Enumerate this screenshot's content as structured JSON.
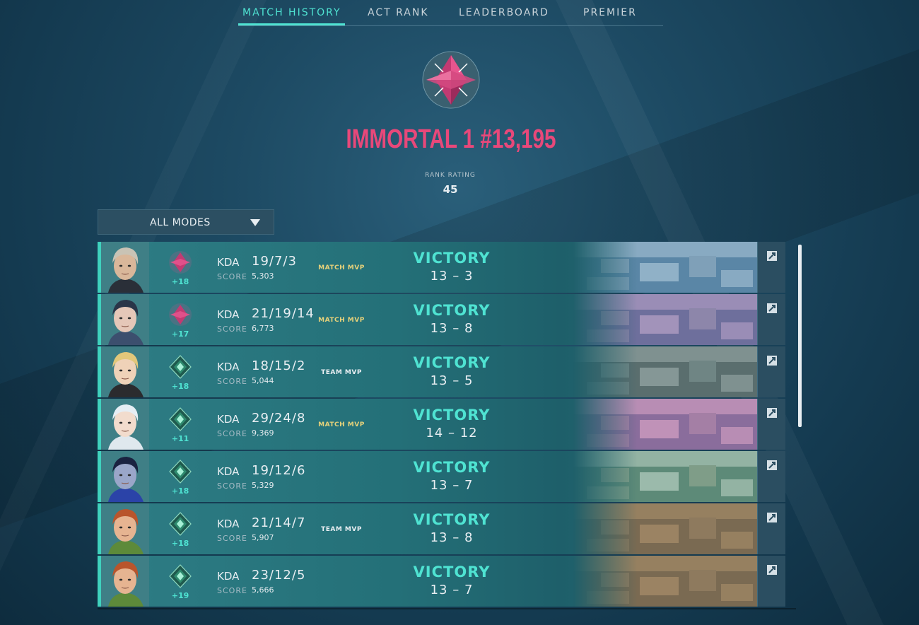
{
  "nav": {
    "tabs": [
      {
        "label": "MATCH HISTORY",
        "active": true
      },
      {
        "label": "ACT RANK",
        "active": false
      },
      {
        "label": "LEADERBOARD",
        "active": false
      },
      {
        "label": "PREMIER",
        "active": false
      }
    ]
  },
  "rank": {
    "title": "IMMORTAL 1 #13,195",
    "rating_label": "RANK RATING",
    "rating_value": "45",
    "icon": "immortal-rank-emblem"
  },
  "filter": {
    "label": "ALL MODES",
    "icon": "chevron-down-icon"
  },
  "matches": [
    {
      "rr": "+18",
      "kda_label": "KDA",
      "kda": "19/7/3",
      "score_label": "SCORE",
      "score": "5,303",
      "mvp": "MATCH MVP",
      "result": "VICTORY",
      "final": "13 – 3",
      "rank_icon": "immortal",
      "map_tone": "blue"
    },
    {
      "rr": "+17",
      "kda_label": "KDA",
      "kda": "21/19/14",
      "score_label": "SCORE",
      "score": "6,773",
      "mvp": "MATCH MVP",
      "result": "VICTORY",
      "final": "13 – 8",
      "rank_icon": "immortal",
      "map_tone": "purple"
    },
    {
      "rr": "+18",
      "kda_label": "KDA",
      "kda": "18/15/2",
      "score_label": "SCORE",
      "score": "5,044",
      "mvp": "TEAM MVP",
      "result": "VICTORY",
      "final": "13 – 5",
      "rank_icon": "ascendant",
      "map_tone": "gray"
    },
    {
      "rr": "+11",
      "kda_label": "KDA",
      "kda": "29/24/8",
      "score_label": "SCORE",
      "score": "9,369",
      "mvp": "MATCH MVP",
      "result": "VICTORY",
      "final": "14 – 12",
      "rank_icon": "ascendant",
      "map_tone": "pink"
    },
    {
      "rr": "+18",
      "kda_label": "KDA",
      "kda": "19/12/6",
      "score_label": "SCORE",
      "score": "5,329",
      "mvp": "",
      "result": "VICTORY",
      "final": "13 – 7",
      "rank_icon": "ascendant",
      "map_tone": "green"
    },
    {
      "rr": "+18",
      "kda_label": "KDA",
      "kda": "21/14/7",
      "score_label": "SCORE",
      "score": "5,907",
      "mvp": "TEAM MVP",
      "result": "VICTORY",
      "final": "13 – 8",
      "rank_icon": "ascendant",
      "map_tone": "tan"
    },
    {
      "rr": "+19",
      "kda_label": "KDA",
      "kda": "23/12/5",
      "score_label": "SCORE",
      "score": "5,666",
      "mvp": "",
      "result": "VICTORY",
      "final": "13 – 7",
      "rank_icon": "ascendant",
      "map_tone": "tan"
    }
  ],
  "colors": {
    "accent": "#4fe3d2",
    "immortal": "#e8487a",
    "mvp_gold": "#e8d27a"
  }
}
